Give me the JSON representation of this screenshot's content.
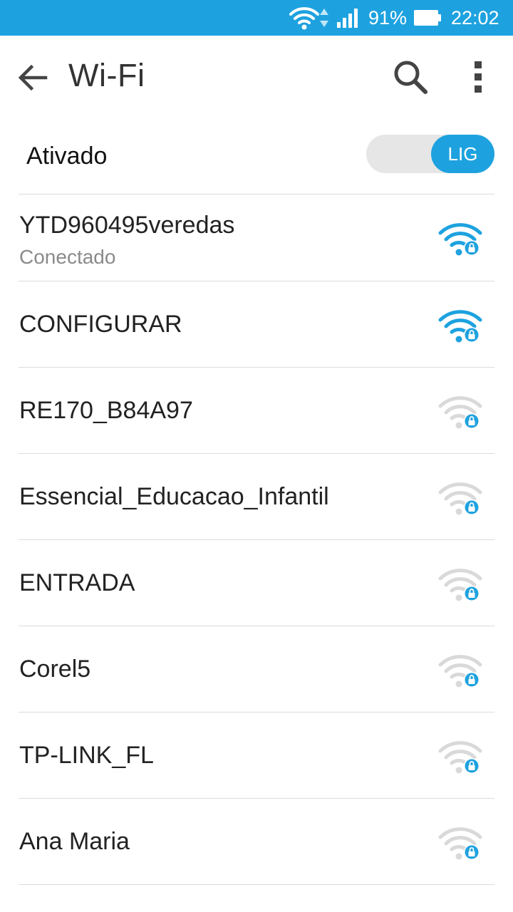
{
  "status_bar": {
    "battery_percent": "91%",
    "time": "22:02",
    "icons": [
      "wifi-icon",
      "data-arrows-icon",
      "signal-icon",
      "battery-icon"
    ]
  },
  "app_bar": {
    "title": "Wi-Fi",
    "icons": [
      "back-arrow-icon",
      "search-icon",
      "more-vert-icon"
    ]
  },
  "wifi_toggle": {
    "label": "Ativado",
    "switch_text": "LIG",
    "on": true
  },
  "networks": [
    {
      "name": "YTD960495veredas",
      "status": "Conectado",
      "active": true,
      "secured": true
    },
    {
      "name": "CONFIGURAR",
      "status": "",
      "active": true,
      "secured": true
    },
    {
      "name": "RE170_B84A97",
      "status": "",
      "active": false,
      "secured": true
    },
    {
      "name": "Essencial_Educacao_Infantil",
      "status": "",
      "active": false,
      "secured": true
    },
    {
      "name": "ENTRADA",
      "status": "",
      "active": false,
      "secured": true
    },
    {
      "name": "Corel5",
      "status": "",
      "active": false,
      "secured": true
    },
    {
      "name": "TP-LINK_FL",
      "status": "",
      "active": false,
      "secured": true
    },
    {
      "name": "Ana Maria",
      "status": "",
      "active": false,
      "secured": true
    }
  ],
  "colors": {
    "accent": "#1ea2df",
    "wifi_strong": "#1ea2df",
    "wifi_weak": "#d9d9d9"
  }
}
